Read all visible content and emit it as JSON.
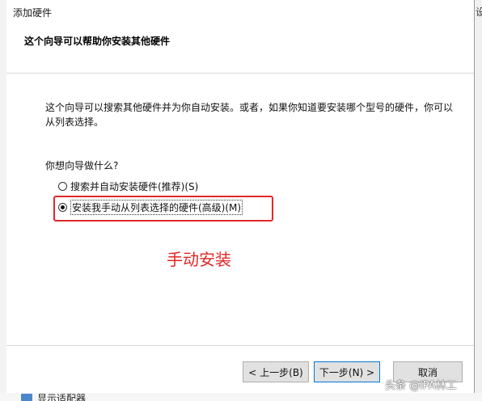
{
  "window": {
    "title": "添加硬件",
    "side_clip_text": "设"
  },
  "header": {
    "text": "这个向导可以帮助你安装其他硬件"
  },
  "content": {
    "description": "这个向导可以搜索其他硬件并为你自动安装。或者，如果你知道要安装哪个型号的硬件，你可以从列表选择。",
    "question": "你想向导做什么?",
    "options": [
      {
        "label": "搜索并自动安装硬件(推荐)(S)",
        "selected": false
      },
      {
        "label": "安装我手动从列表选择的硬件(高级)(M)",
        "selected": true
      }
    ]
  },
  "annotation": {
    "text": "手动安装",
    "color": "#e02828"
  },
  "buttons": {
    "back": "< 上一步(B)",
    "next": "下一步(N) >",
    "cancel": "取消"
  },
  "background": {
    "bottom_item": "显示适配器"
  },
  "watermark": {
    "text": "头条 @iPA林工"
  }
}
